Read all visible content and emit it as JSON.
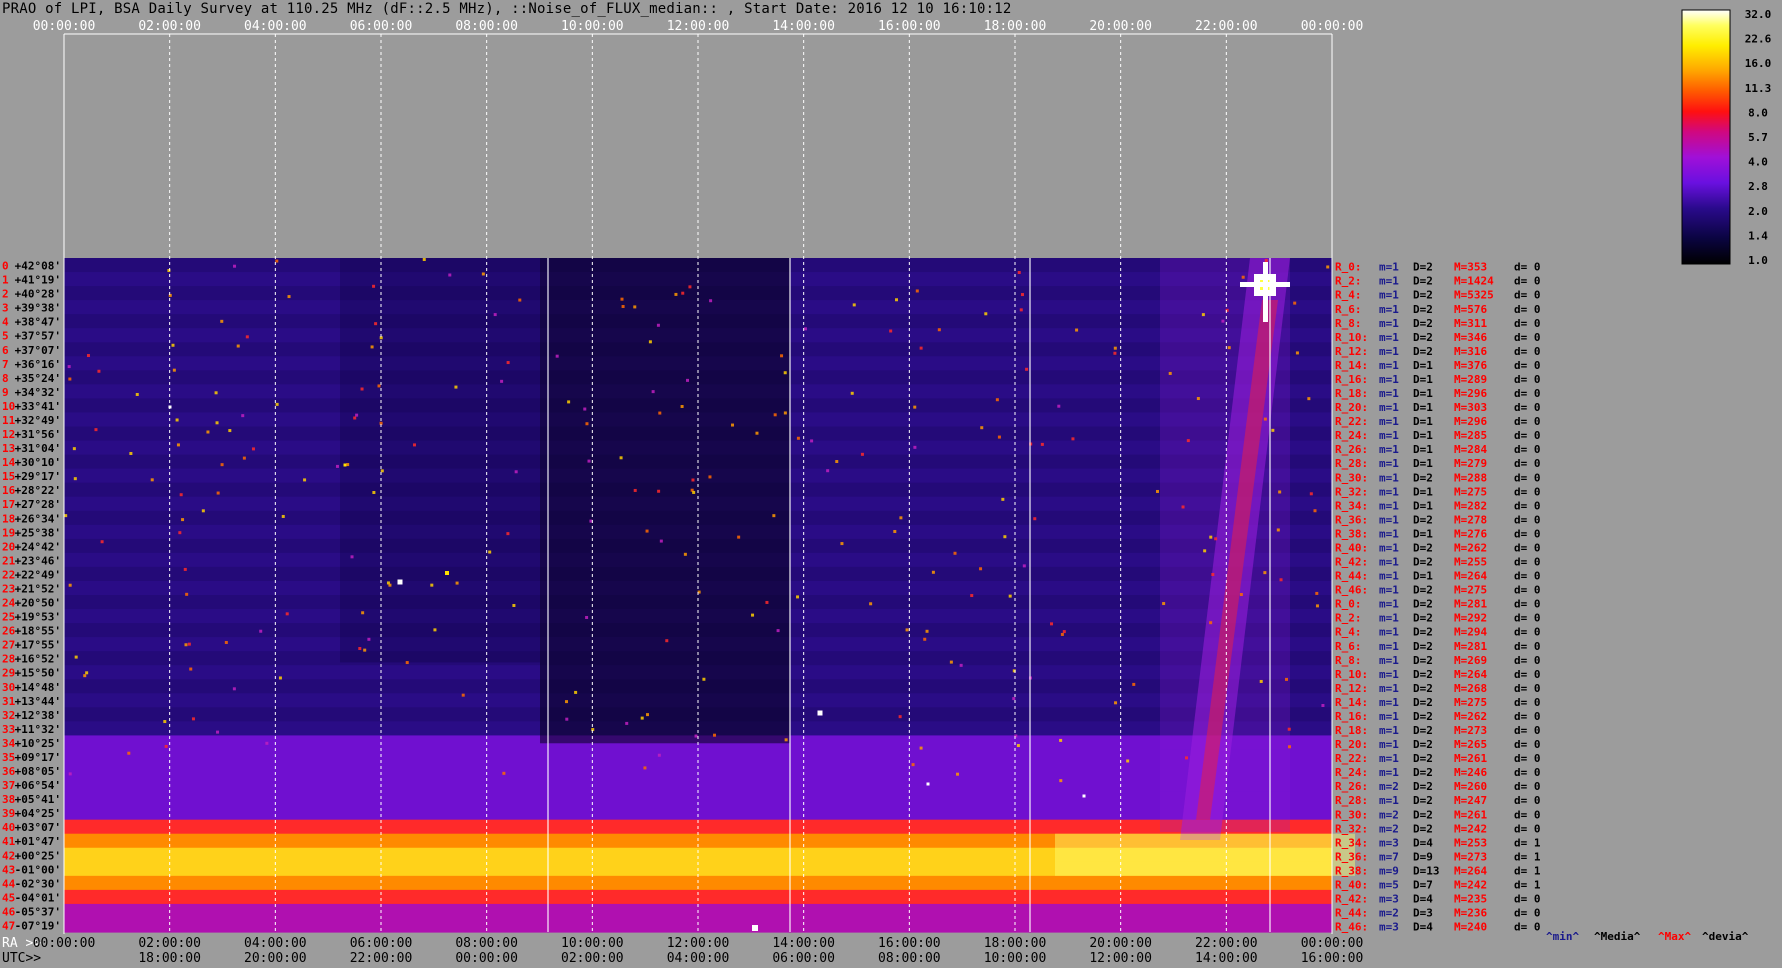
{
  "title": "PRAO of LPI, BSA Daily Survey at 110.25 MHz (dF::2.5 MHz), ::Noise_of_FLUX_median:: , Start Date: 2016 12 10 16:10:12",
  "colors": {
    "background": "#9c9c9c",
    "plot_bg": "#1a0b5a",
    "text": "#000000",
    "label_red": "#ff0000",
    "stats_blue": "#1a1a8c"
  },
  "chart_data": {
    "type": "heatmap",
    "top_axis_labels": [
      "00:00:00",
      "02:00:00",
      "04:00:00",
      "06:00:00",
      "08:00:00",
      "10:00:00",
      "12:00:00",
      "14:00:00",
      "16:00:00",
      "18:00:00",
      "20:00:00",
      "22:00:00",
      "00:00:00"
    ],
    "bottom_axis": {
      "ra_prefix": "RA >>",
      "ra_labels": [
        "00:00:00",
        "02:00:00",
        "04:00:00",
        "06:00:00",
        "08:00:00",
        "10:00:00",
        "12:00:00",
        "14:00:00",
        "16:00:00",
        "18:00:00",
        "20:00:00",
        "22:00:00",
        "00:00:00"
      ],
      "utc_prefix": "UTC>>",
      "utc_labels": [
        "18:00:00",
        "20:00:00",
        "22:00:00",
        "00:00:00",
        "02:00:00",
        "04:00:00",
        "06:00:00",
        "08:00:00",
        "10:00:00",
        "12:00:00",
        "14:00:00",
        "16:00:00"
      ]
    },
    "declinations": [
      "+42°08'",
      "+41°19'",
      "+40°28'",
      "+39°38'",
      "+38°47'",
      "+37°57'",
      "+37°07'",
      "+36°16'",
      "+35°24'",
      "+34°32'",
      "+33°41'",
      "+32°49'",
      "+31°56'",
      "+31°04'",
      "+30°10'",
      "+29°17'",
      "+28°22'",
      "+27°28'",
      "+26°34'",
      "+25°38'",
      "+24°42'",
      "+23°46'",
      "+22°49'",
      "+21°52'",
      "+20°50'",
      "+19°53'",
      "+18°55'",
      "+17°55'",
      "+16°52'",
      "+15°50'",
      "+14°48'",
      "+13°44'",
      "+12°38'",
      "+11°32'",
      "+10°25'",
      "+09°17'",
      "+08°05'",
      "+06°54'",
      "+05°41'",
      "+04°25'",
      "+03°07'",
      "+01°47'",
      "+00°25'",
      "-01°00'",
      "-02°30'",
      "-04°01'",
      "-05°37'",
      "-07°19'"
    ],
    "beam_numbers": [
      "0",
      "1",
      "2",
      "3",
      "4",
      "5",
      "6",
      "7",
      "8",
      "9",
      "10",
      "11",
      "12",
      "13",
      "14",
      "15",
      "16",
      "17",
      "18",
      "19",
      "20",
      "21",
      "22",
      "23",
      "24",
      "25",
      "26",
      "27",
      "28",
      "29",
      "30",
      "31",
      "32",
      "33",
      "34",
      "35",
      "36",
      "37",
      "38",
      "39",
      "40",
      "41",
      "42",
      "43",
      "44",
      "45",
      "46",
      "47"
    ],
    "right_stats": [
      {
        "r": "R_0:",
        "m": "m=1",
        "D": "D=2",
        "M": "M=353",
        "d": "d= 0"
      },
      {
        "r": "R_2:",
        "m": "m=1",
        "D": "D=2",
        "M": "M=1424",
        "d": "d= 0"
      },
      {
        "r": "R_4:",
        "m": "m=1",
        "D": "D=2",
        "M": "M=5325",
        "d": "d= 0"
      },
      {
        "r": "R_6:",
        "m": "m=1",
        "D": "D=2",
        "M": "M=576",
        "d": "d= 0"
      },
      {
        "r": "R_8:",
        "m": "m=1",
        "D": "D=2",
        "M": "M=311",
        "d": "d= 0"
      },
      {
        "r": "R_10:",
        "m": "m=1",
        "D": "D=2",
        "M": "M=346",
        "d": "d= 0"
      },
      {
        "r": "R_12:",
        "m": "m=1",
        "D": "D=2",
        "M": "M=316",
        "d": "d= 0"
      },
      {
        "r": "R_14:",
        "m": "m=1",
        "D": "D=1",
        "M": "M=376",
        "d": "d= 0"
      },
      {
        "r": "R_16:",
        "m": "m=1",
        "D": "D=1",
        "M": "M=289",
        "d": "d= 0"
      },
      {
        "r": "R_18:",
        "m": "m=1",
        "D": "D=1",
        "M": "M=296",
        "d": "d= 0"
      },
      {
        "r": "R_20:",
        "m": "m=1",
        "D": "D=1",
        "M": "M=303",
        "d": "d= 0"
      },
      {
        "r": "R_22:",
        "m": "m=1",
        "D": "D=1",
        "M": "M=296",
        "d": "d= 0"
      },
      {
        "r": "R_24:",
        "m": "m=1",
        "D": "D=1",
        "M": "M=285",
        "d": "d= 0"
      },
      {
        "r": "R_26:",
        "m": "m=1",
        "D": "D=1",
        "M": "M=284",
        "d": "d= 0"
      },
      {
        "r": "R_28:",
        "m": "m=1",
        "D": "D=1",
        "M": "M=279",
        "d": "d= 0"
      },
      {
        "r": "R_30:",
        "m": "m=1",
        "D": "D=2",
        "M": "M=288",
        "d": "d= 0"
      },
      {
        "r": "R_32:",
        "m": "m=1",
        "D": "D=1",
        "M": "M=275",
        "d": "d= 0"
      },
      {
        "r": "R_34:",
        "m": "m=1",
        "D": "D=1",
        "M": "M=282",
        "d": "d= 0"
      },
      {
        "r": "R_36:",
        "m": "m=1",
        "D": "D=2",
        "M": "M=278",
        "d": "d= 0"
      },
      {
        "r": "R_38:",
        "m": "m=1",
        "D": "D=1",
        "M": "M=276",
        "d": "d= 0"
      },
      {
        "r": "R_40:",
        "m": "m=1",
        "D": "D=2",
        "M": "M=262",
        "d": "d= 0"
      },
      {
        "r": "R_42:",
        "m": "m=1",
        "D": "D=2",
        "M": "M=255",
        "d": "d= 0"
      },
      {
        "r": "R_44:",
        "m": "m=1",
        "D": "D=1",
        "M": "M=264",
        "d": "d= 0"
      },
      {
        "r": "R_46:",
        "m": "m=1",
        "D": "D=2",
        "M": "M=275",
        "d": "d= 0"
      },
      {
        "r": "R_0:",
        "m": "m=1",
        "D": "D=2",
        "M": "M=281",
        "d": "d= 0"
      },
      {
        "r": "R_2:",
        "m": "m=1",
        "D": "D=2",
        "M": "M=292",
        "d": "d= 0"
      },
      {
        "r": "R_4:",
        "m": "m=1",
        "D": "D=2",
        "M": "M=294",
        "d": "d= 0"
      },
      {
        "r": "R_6:",
        "m": "m=1",
        "D": "D=2",
        "M": "M=281",
        "d": "d= 0"
      },
      {
        "r": "R_8:",
        "m": "m=1",
        "D": "D=2",
        "M": "M=269",
        "d": "d= 0"
      },
      {
        "r": "R_10:",
        "m": "m=1",
        "D": "D=2",
        "M": "M=264",
        "d": "d= 0"
      },
      {
        "r": "R_12:",
        "m": "m=1",
        "D": "D=2",
        "M": "M=268",
        "d": "d= 0"
      },
      {
        "r": "R_14:",
        "m": "m=1",
        "D": "D=2",
        "M": "M=275",
        "d": "d= 0"
      },
      {
        "r": "R_16:",
        "m": "m=1",
        "D": "D=2",
        "M": "M=262",
        "d": "d= 0"
      },
      {
        "r": "R_18:",
        "m": "m=1",
        "D": "D=2",
        "M": "M=273",
        "d": "d= 0"
      },
      {
        "r": "R_20:",
        "m": "m=1",
        "D": "D=2",
        "M": "M=265",
        "d": "d= 0"
      },
      {
        "r": "R_22:",
        "m": "m=1",
        "D": "D=2",
        "M": "M=261",
        "d": "d= 0"
      },
      {
        "r": "R_24:",
        "m": "m=1",
        "D": "D=2",
        "M": "M=246",
        "d": "d= 0"
      },
      {
        "r": "R_26:",
        "m": "m=2",
        "D": "D=2",
        "M": "M=260",
        "d": "d= 0"
      },
      {
        "r": "R_28:",
        "m": "m=1",
        "D": "D=2",
        "M": "M=247",
        "d": "d= 0"
      },
      {
        "r": "R_30:",
        "m": "m=2",
        "D": "D=2",
        "M": "M=261",
        "d": "d= 0"
      },
      {
        "r": "R_32:",
        "m": "m=2",
        "D": "D=2",
        "M": "M=242",
        "d": "d= 0"
      },
      {
        "r": "R_34:",
        "m": "m=3",
        "D": "D=4",
        "M": "M=253",
        "d": "d= 1"
      },
      {
        "r": "R_36:",
        "m": "m=7",
        "D": "D=9",
        "M": "M=273",
        "d": "d= 1"
      },
      {
        "r": "R_38:",
        "m": "m=9",
        "D": "D=13",
        "M": "M=264",
        "d": "d= 1"
      },
      {
        "r": "R_40:",
        "m": "m=5",
        "D": "D=7",
        "M": "M=242",
        "d": "d= 1"
      },
      {
        "r": "R_42:",
        "m": "m=3",
        "D": "D=4",
        "M": "M=235",
        "d": "d= 0"
      },
      {
        "r": "R_44:",
        "m": "m=2",
        "D": "D=3",
        "M": "M=236",
        "d": "d= 0"
      },
      {
        "r": "R_46:",
        "m": "m=3",
        "D": "D=4",
        "M": "M=240",
        "d": "d= 0"
      }
    ],
    "stat_legend": [
      "^min^",
      "^Media^",
      "^Max^",
      "^devia^"
    ],
    "colorbar": {
      "ticks": [
        "32.0",
        "22.6",
        "16.0",
        "11.3",
        "8.0",
        "5.7",
        "4.0",
        "2.8",
        "2.0",
        "1.4",
        "1.0"
      ],
      "scale": "log",
      "range": [
        1.0,
        32.0
      ]
    }
  }
}
